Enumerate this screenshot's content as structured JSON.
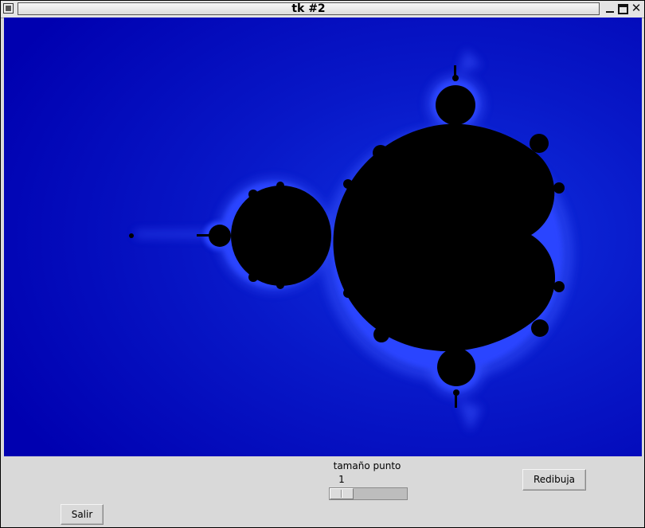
{
  "window": {
    "title": "tk #2"
  },
  "canvas": {
    "background": "#0000b8",
    "set_color": "#000000",
    "glow_color": "#3a55ff",
    "image": "mandelbrot-set"
  },
  "slider": {
    "label": "tamaño punto",
    "value": "1",
    "fraction": 0.0
  },
  "buttons": {
    "redraw": "Redibuja",
    "quit": "Salir"
  }
}
